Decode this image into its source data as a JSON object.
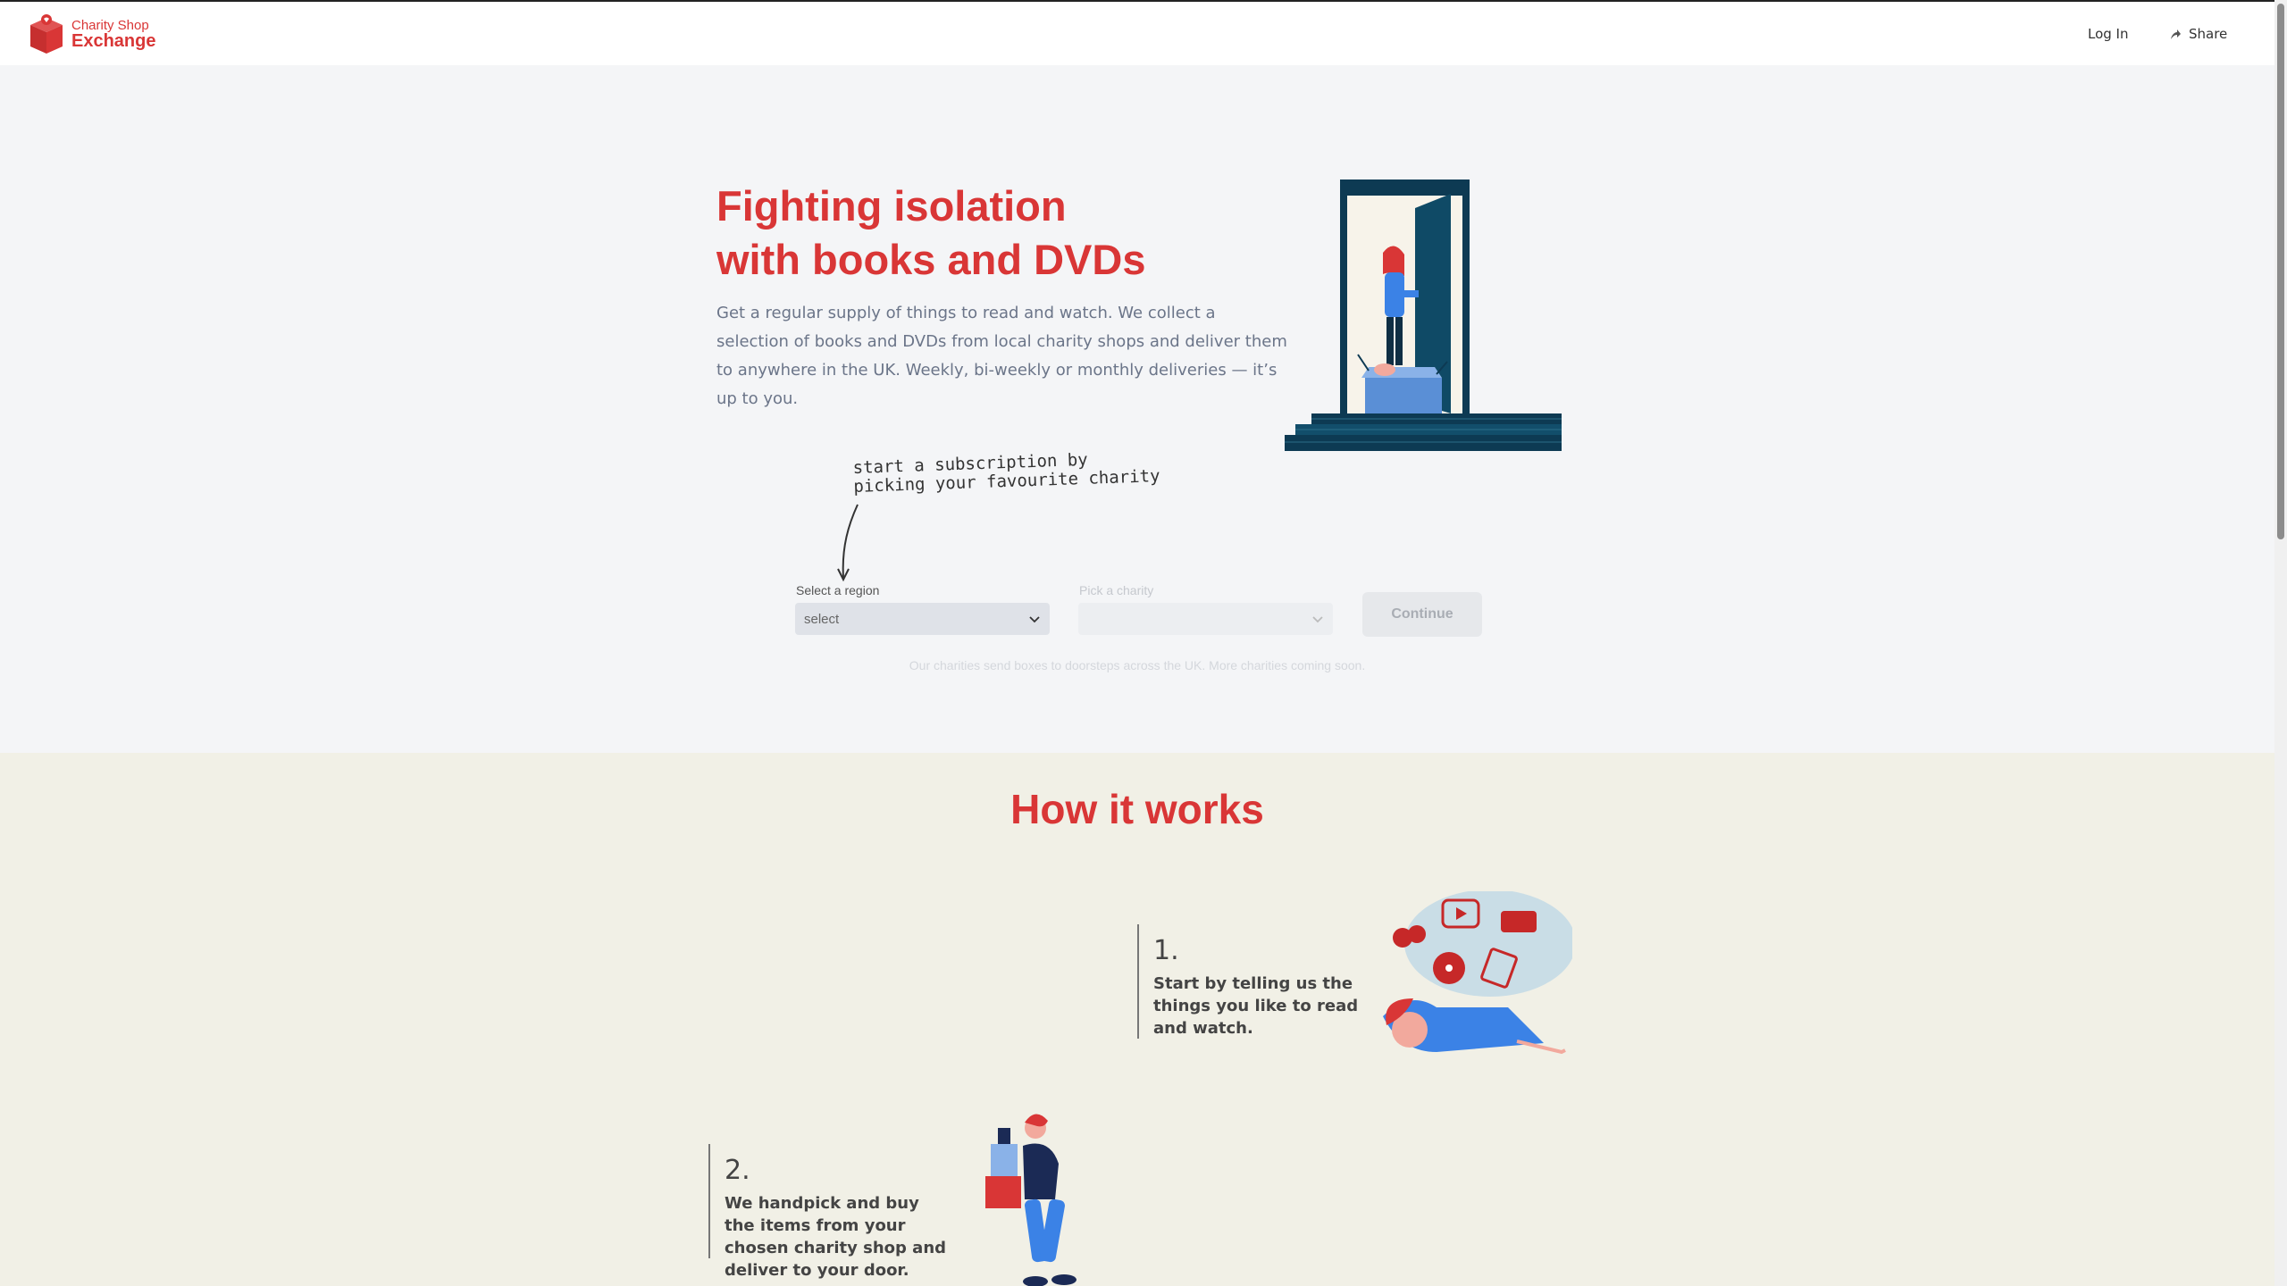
{
  "header": {
    "logo_line1": "Charity Shop",
    "logo_line2": "Exchange",
    "login_label": "Log In",
    "share_label": "Share"
  },
  "hero": {
    "title_line1": "Fighting isolation",
    "title_line2": "with books and DVDs",
    "description": "Get a regular supply of things to read and watch. We collect a selection of books and DVDs from local charity shops and deliver them to anywhere in the UK. Weekly, bi-weekly or monthly deliveries — it’s up to you.",
    "handnote_line1": "start a subscription by",
    "handnote_line2": "picking your favourite charity"
  },
  "form": {
    "region_label": "Select a region",
    "region_value": "select",
    "charity_label": "Pick a charity",
    "charity_value": "",
    "continue_label": "Continue",
    "coverage_note": "Our charities send boxes to doorsteps across the UK. More charities coming soon."
  },
  "how": {
    "title": "How it works",
    "steps": [
      {
        "number": "1.",
        "text": "Start by telling us the things you like to read and watch."
      },
      {
        "number": "2.",
        "text": "We handpick and buy the items from your chosen charity shop and deliver to your door."
      }
    ]
  },
  "colors": {
    "brand_red": "#d93636",
    "hero_bg": "#f4f5f7",
    "how_bg": "#f1f0e6",
    "navy": "#0d3a53",
    "accent_blue": "#3b82e6"
  },
  "icons": [
    "logo-box-icon",
    "share-arrow-icon",
    "chevron-down-icon",
    "hand-drawn-arrow-icon"
  ]
}
